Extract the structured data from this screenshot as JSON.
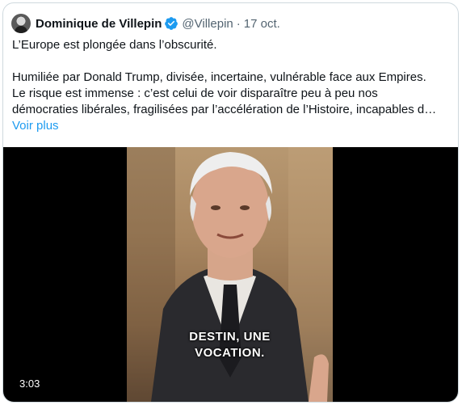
{
  "tweet": {
    "author_name": "Dominique de Villepin",
    "handle": "@Villepin",
    "separator": "·",
    "date": "17 oct.",
    "lines": [
      "L’Europe est plongée dans l’obscurité.",
      "Humiliée par Donald Trump, divisée, incertaine, vulnérable face aux Empires.",
      "Le risque est immense : c’est celui de voir disparaître peu à peu nos",
      "démocraties libérales, fragilisées par l’accélération de l’Histoire, incapables d…"
    ],
    "more_label": "Voir plus"
  },
  "video": {
    "subtitle_line1": "DESTIN, UNE",
    "subtitle_line2": "VOCATION.",
    "duration": "3:03"
  },
  "colors": {
    "link": "#1d9bf0",
    "muted": "#536471",
    "verified": "#1d9bf0"
  },
  "icons": {
    "verified": "verified-badge-icon",
    "avatar": "profile-avatar"
  }
}
